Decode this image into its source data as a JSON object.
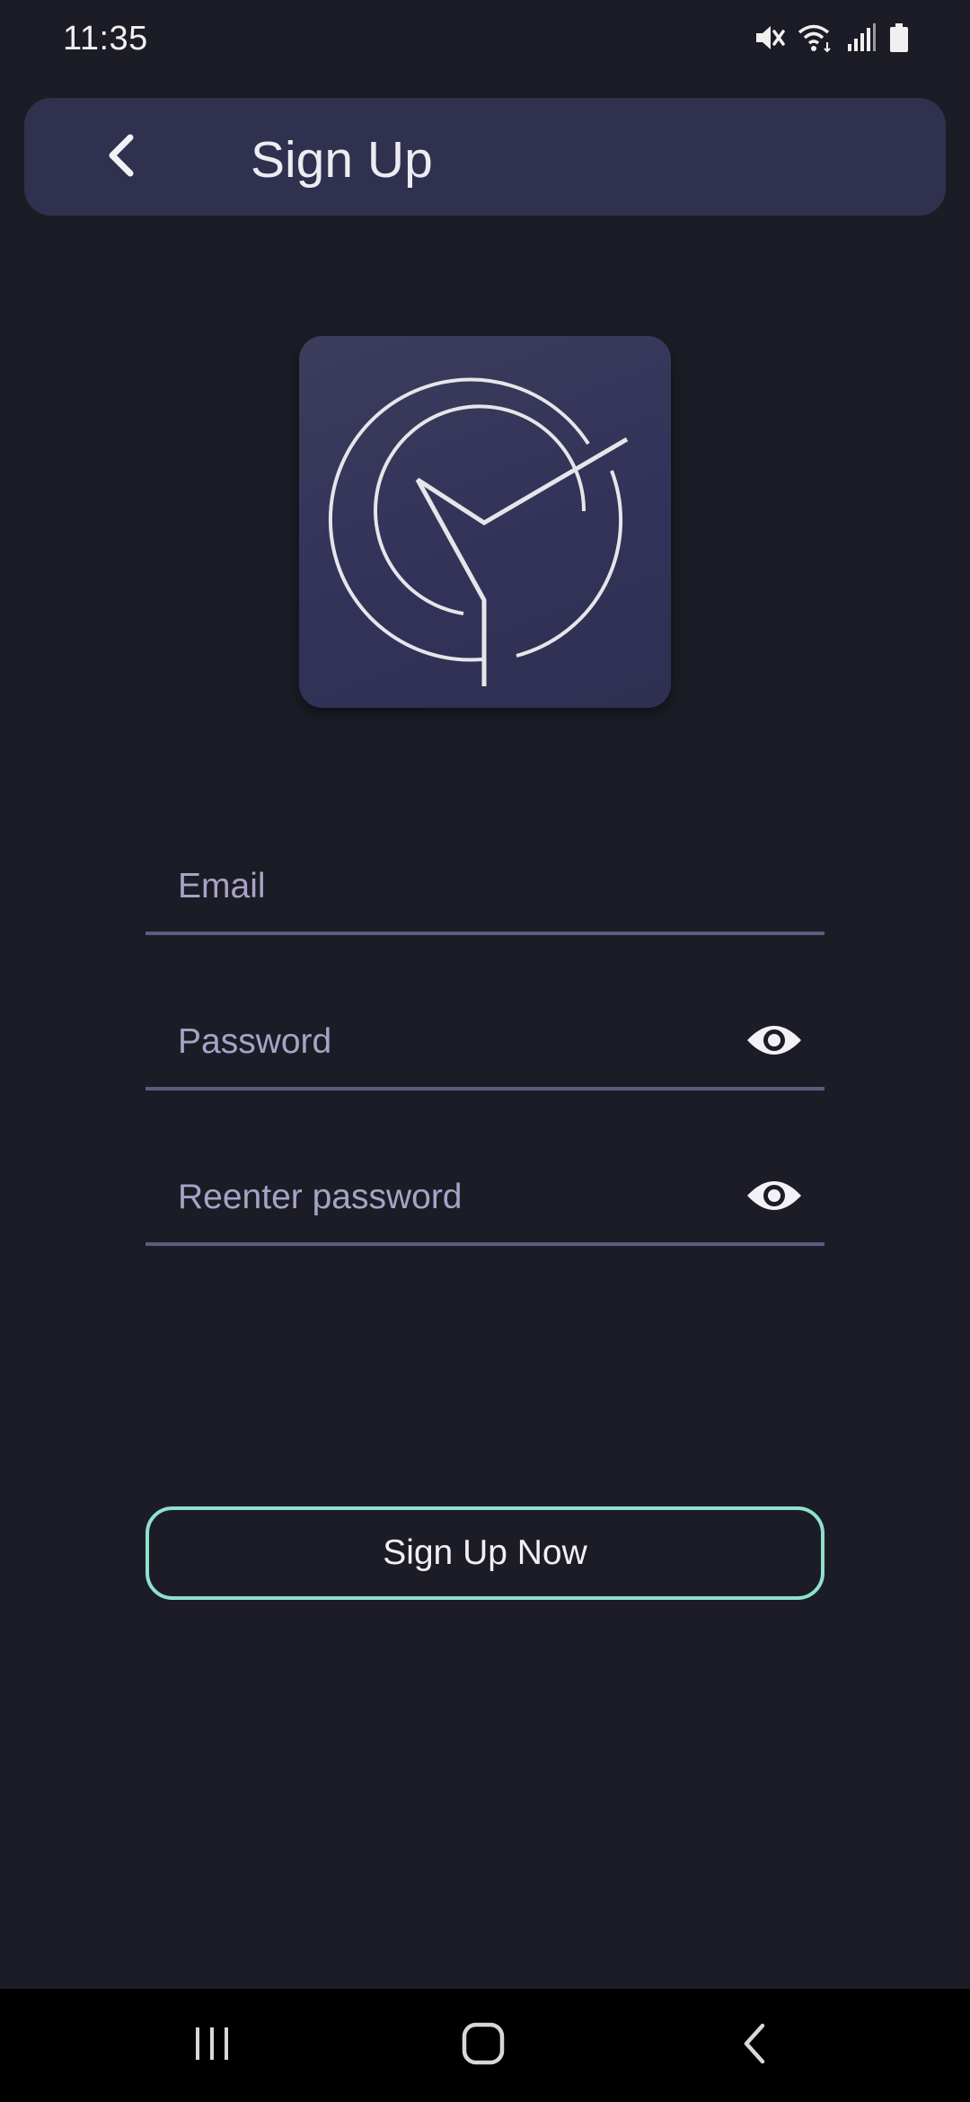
{
  "status_bar": {
    "time": "11:35",
    "icons": [
      "mute-icon",
      "wifi-icon",
      "signal-icon",
      "battery-icon"
    ]
  },
  "header": {
    "title": "Sign Up",
    "back_icon": "chevron-left-icon"
  },
  "logo": {
    "icon": "clock-logo-icon"
  },
  "form": {
    "email_placeholder": "Email",
    "password_placeholder": "Password",
    "repassword_placeholder": "Reenter password",
    "visibility_icon": "eye-icon"
  },
  "actions": {
    "signup_label": "Sign Up Now"
  },
  "nav_bar": {
    "icons": [
      "recent-apps-icon",
      "home-icon",
      "back-icon"
    ]
  },
  "colors": {
    "background": "#1c1c26",
    "app_bar": "#30304f",
    "button_border": "#8fe0cc",
    "placeholder": "#a7a3c6",
    "underline": "#5e5a80"
  }
}
